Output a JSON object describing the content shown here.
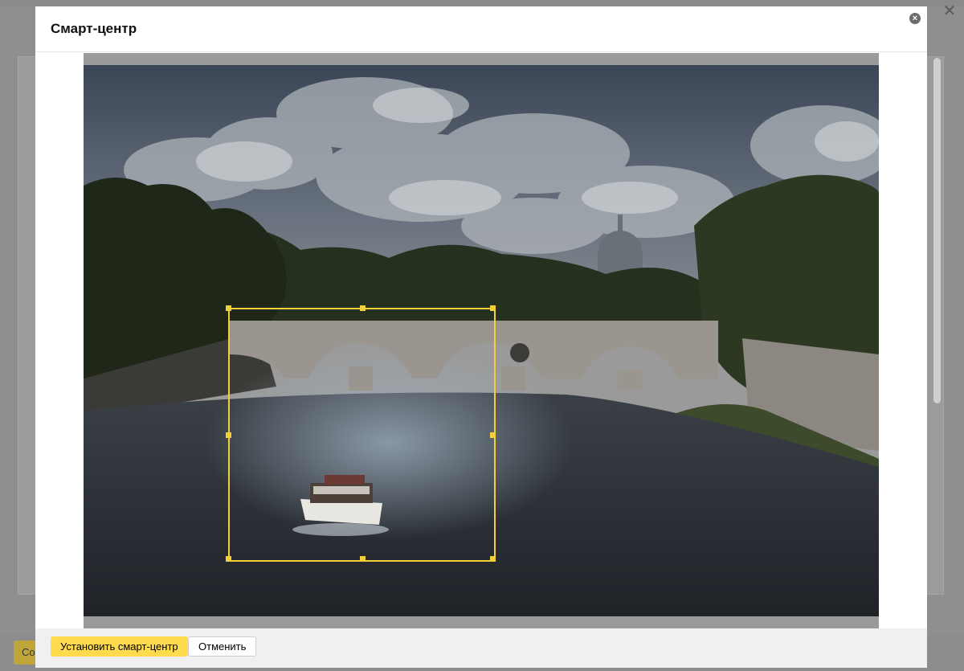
{
  "modal": {
    "title": "Смарт-центр",
    "close_icon": "close-circle-icon"
  },
  "background": {
    "button_label": "Со",
    "close_icon": "close-icon"
  },
  "image": {
    "subject": "river-bridge-boat-photo"
  },
  "footer": {
    "primary_label": "Установить смарт-центр",
    "secondary_label": "Отменить"
  },
  "colors": {
    "accent": "#ffdb4d",
    "crop_border": "#f2cf3b",
    "overlay": "#8f8f8f"
  }
}
